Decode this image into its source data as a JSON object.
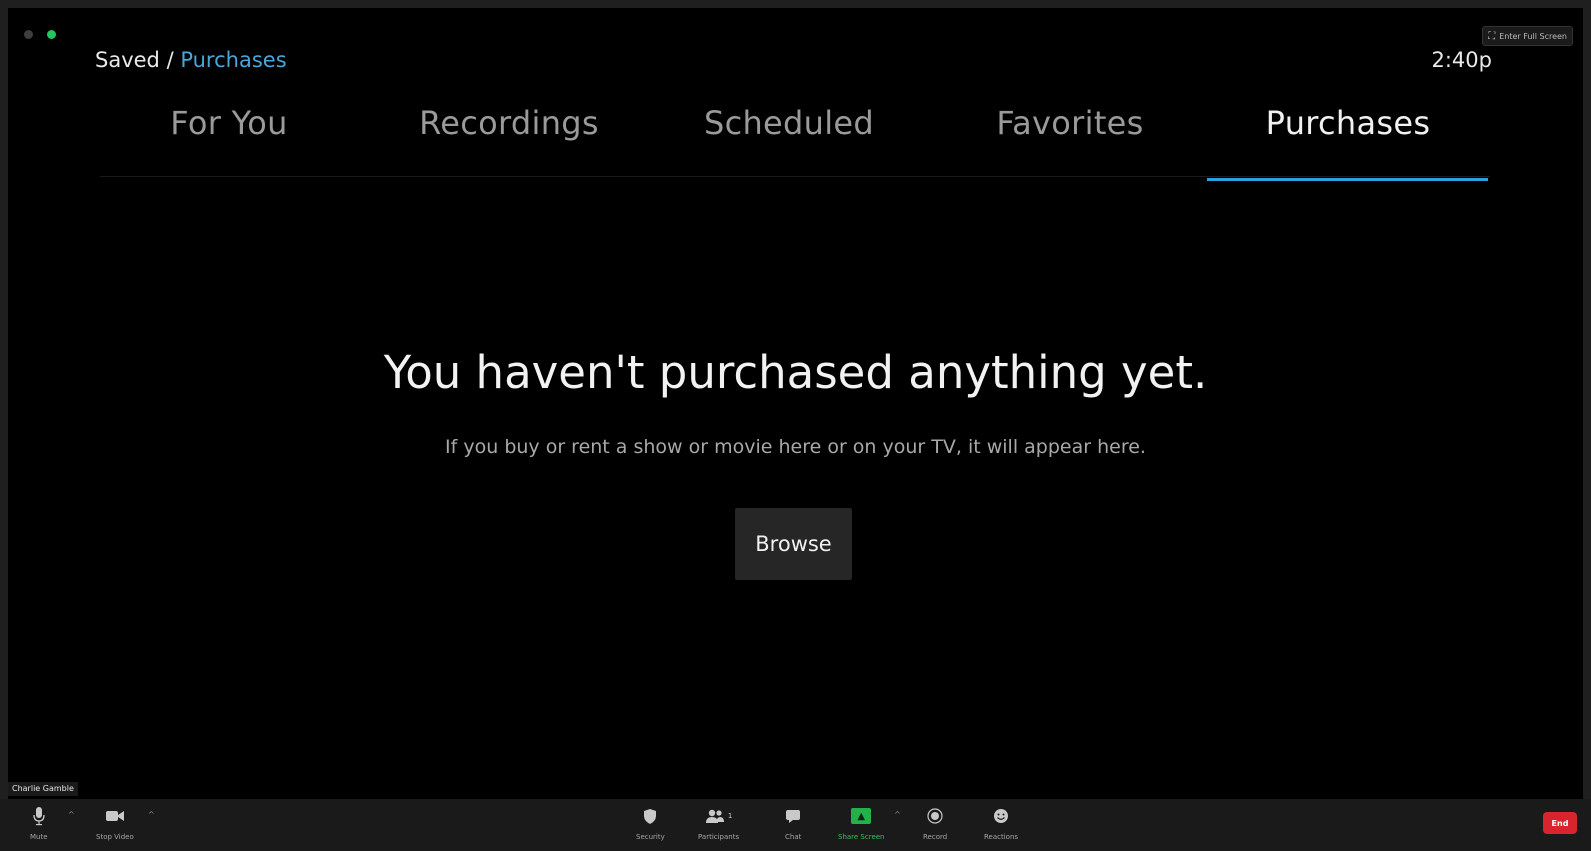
{
  "window": {
    "fullscreen_label": "Enter Full Screen"
  },
  "header": {
    "breadcrumb_parent": "Saved",
    "breadcrumb_separator": " / ",
    "breadcrumb_current": "Purchases",
    "clock": "2:40p"
  },
  "tabs": [
    {
      "label": "For You",
      "active": false
    },
    {
      "label": "Recordings",
      "active": false
    },
    {
      "label": "Scheduled",
      "active": false
    },
    {
      "label": "Favorites",
      "active": false
    },
    {
      "label": "Purchases",
      "active": true
    }
  ],
  "empty_state": {
    "title": "You haven't purchased anything yet.",
    "subtitle": "If you buy or rent a show or movie here or on your TV, it will appear here.",
    "button": "Browse"
  },
  "participant": {
    "name": "Charlie Gamble"
  },
  "toolbar": {
    "mute": "Mute",
    "stop_video": "Stop Video",
    "security": "Security",
    "participants": "Participants",
    "participants_count": "1",
    "chat": "Chat",
    "share_screen": "Share Screen",
    "record": "Record",
    "reactions": "Reactions",
    "end": "End"
  },
  "colors": {
    "accent": "#2aa2e0",
    "breadcrumb_active": "#48a6d8",
    "share_green": "#23b24a",
    "end_red": "#d7242d",
    "background": "#000000"
  }
}
